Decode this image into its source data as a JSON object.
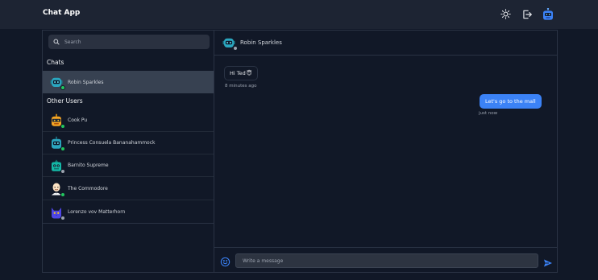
{
  "app": {
    "title": "Chat App"
  },
  "navbar": {
    "icons": [
      "sun-icon",
      "logout-icon",
      "robot-avatar-icon"
    ]
  },
  "sidebar": {
    "search": {
      "placeholder": "Search",
      "value": ""
    },
    "chats_label": "Chats",
    "chats": [
      {
        "name": "Robin Sparkles",
        "status": "online",
        "active": true,
        "avatar": "teal-robot"
      }
    ],
    "others_label": "Other Users",
    "others": [
      {
        "name": "Cook Pu",
        "status": "online",
        "avatar": "orange-robot"
      },
      {
        "name": "Princess Consuela Bananahammock",
        "status": "online",
        "avatar": "teal-robot"
      },
      {
        "name": "Barnito Supreme",
        "status": "offline",
        "avatar": "green-robot"
      },
      {
        "name": "The Commodore",
        "status": "online",
        "avatar": "bald-man"
      },
      {
        "name": "Lorenzo vov Matterhorn",
        "status": "offline",
        "avatar": "blue-cat"
      }
    ]
  },
  "chat": {
    "header_name": "Robin Sparkles",
    "messages": [
      {
        "direction": "incoming",
        "text": "Hi Ted",
        "emoji": "😇",
        "time": "8 minutes ago"
      },
      {
        "direction": "outgoing",
        "text": "Let's go to the mall",
        "time": "just now"
      }
    ],
    "composer": {
      "placeholder": "Write a message",
      "value": ""
    }
  },
  "colors": {
    "background": "#111827",
    "navbar": "#1d2433",
    "accent": "#3b82f6",
    "online": "#22c55e",
    "offline": "#9ca3af"
  }
}
